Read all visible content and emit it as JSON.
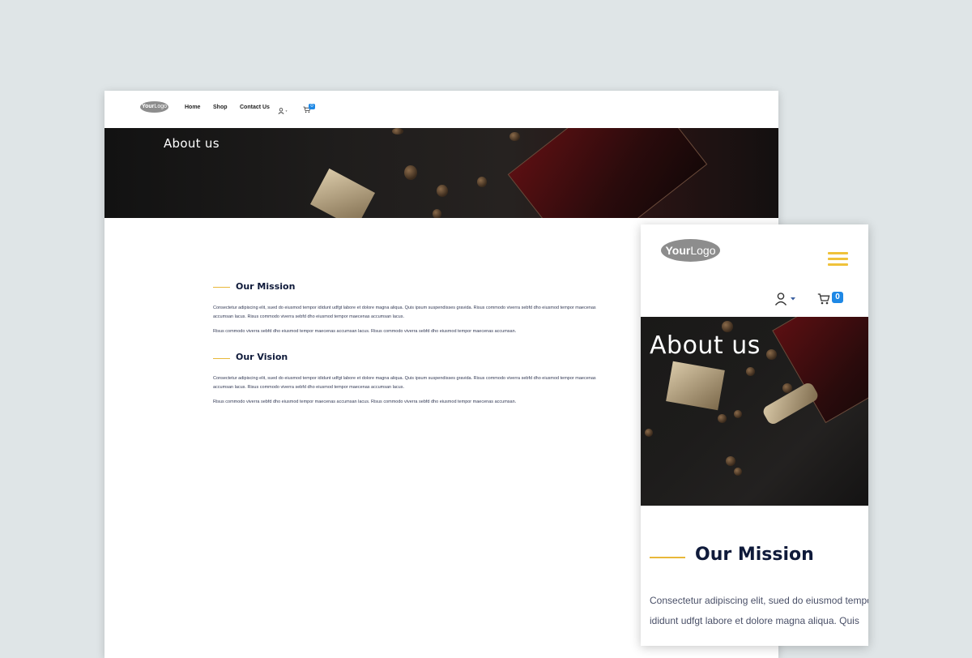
{
  "desktop": {
    "logo": {
      "bold": "Your",
      "light": "Logo"
    },
    "nav": {
      "home": "Home",
      "shop": "Shop",
      "contact": "Contact Us"
    },
    "cart_count": "0",
    "hero_title": "About us",
    "mission": {
      "title": "Our Mission",
      "para1": "Consectetur adipiscing elit, sued do eiusmod tempor ididunt udfgt labore et dolore magna aliqua. Quis ipsum suspendisses gravida. Risus commodo viverra sebfd dho eiusmod tempor maecenas accumsan lacus. Risus commodo viverra sebfd dho eiusmod tempor maecenas accumsan lacus.",
      "para2": "Risus commodo viverra sebfd dho eiusmod tempor maecenas accumsan lacus. Risus commodo viverra sebfd dho eiusmod tempor maecenas accumsan."
    },
    "vision": {
      "title": "Our Vision",
      "para1": "Consectetur adipiscing elit, sued do eiusmod tempor ididunt udfgt labore et dolore magna aliqua. Quis ipsum suspendisses gravida. Risus commodo viverra sebfd dho eiusmod tempor maecenas accumsan lacus. Risus commodo viverra sebfd dho eiusmod tempor maecenas accumsan lacus.",
      "para2": "Risus commodo viverra sebfd dho eiusmod tempor maecenas accumsan lacus. Risus commodo viverra sebfd dho eiusmod tempor maecenas accumsan."
    }
  },
  "mobile": {
    "logo": {
      "bold": "Your",
      "light": "Logo"
    },
    "cart_count": "0",
    "hero_title": "About us",
    "mission_title": "Our Mission",
    "para_line1": "Consectetur adipiscing elit, sued do eiusmod tempor",
    "para_line2": "ididunt udfgt labore et dolore magna aliqua. Quis"
  },
  "colors": {
    "accent": "#e8b83a",
    "heading": "#0f1a3a",
    "badge": "#1e88e5",
    "background": "#dfe5e7"
  },
  "icons": [
    "user-icon",
    "caret-down-icon",
    "cart-icon",
    "hamburger-menu-icon"
  ]
}
